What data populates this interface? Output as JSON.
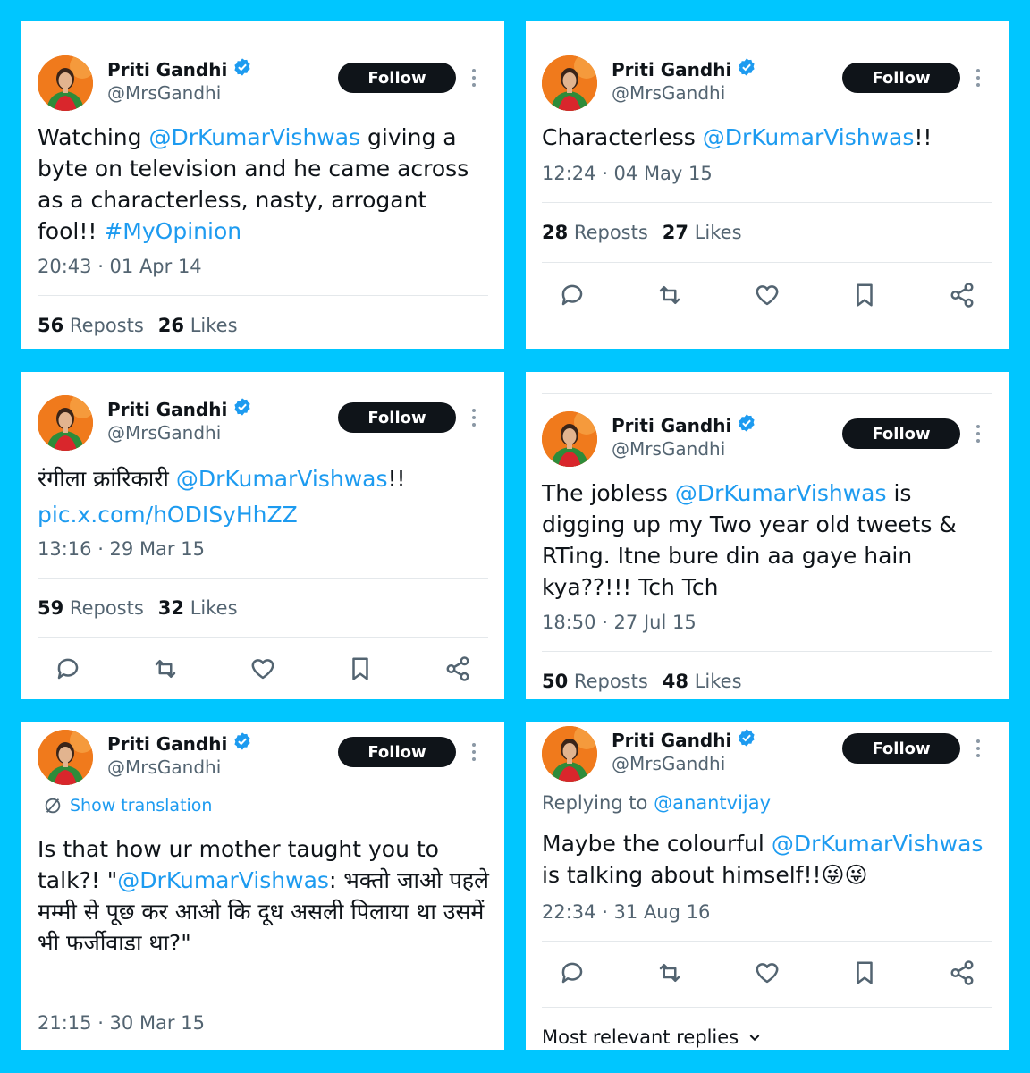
{
  "author": {
    "name": "Priti Gandhi",
    "handle": "@MrsGandhi",
    "follow_label": "Follow"
  },
  "colors": {
    "background": "#00c6ff",
    "link": "#1d9bf0",
    "text": "#0f1419",
    "muted": "#536471"
  },
  "tweets": [
    {
      "parts": [
        "Watching ",
        "@DrKumarVishwas",
        " giving a byte on television and he came across as a characterless, nasty, arrogant fool!! ",
        "#MyOpinion"
      ],
      "timestamp": "20:43 · 01 Apr 14",
      "reposts": "56",
      "reposts_label": "Reposts",
      "likes": "26",
      "likes_label": "Likes"
    },
    {
      "parts": [
        "Characterless ",
        "@DrKumarVishwas",
        "!!"
      ],
      "timestamp": "12:24 · 04 May 15",
      "reposts": "28",
      "reposts_label": "Reposts",
      "likes": "27",
      "likes_label": "Likes"
    },
    {
      "parts": [
        "रंगीला क्रांरिकारी ",
        "@DrKumarVishwas",
        "!!",
        "pic.x.com/hODISyHhZZ"
      ],
      "timestamp": "13:16 · 29 Mar 15",
      "reposts": "59",
      "reposts_label": "Reposts",
      "likes": "32",
      "likes_label": "Likes"
    },
    {
      "parts": [
        "The jobless ",
        "@DrKumarVishwas",
        " is digging up my Two year old tweets & RTing. Itne bure din aa gaye hain kya??!!! Tch Tch"
      ],
      "timestamp": "18:50 · 27 Jul 15",
      "reposts": "50",
      "reposts_label": "Reposts",
      "likes": "48",
      "likes_label": "Likes"
    },
    {
      "translation_label": "Show translation",
      "parts": [
        "Is that how ur mother taught you to talk?! \"",
        "@DrKumarVishwas",
        ": भक्तो जाओ पहले मम्मी से पूछ कर आओ कि दूध असली पिलाया था उसमें भी फर्जीवाडा था?\""
      ],
      "timestamp": "21:15 · 30 Mar 15"
    },
    {
      "replying_label": "Replying to ",
      "replying_handle": "@anantvijay",
      "parts": [
        "Maybe the colourful ",
        "@DrKumarVishwas",
        " is talking about himself!!😜😜"
      ],
      "timestamp": "22:34 · 31 Aug 16",
      "most_relevant_label": "Most relevant replies"
    }
  ],
  "icons": [
    "verified-badge-icon",
    "more-icon",
    "reply-icon",
    "repost-icon",
    "like-icon",
    "bookmark-icon",
    "share-icon",
    "translate-icon",
    "chevron-down-icon"
  ]
}
